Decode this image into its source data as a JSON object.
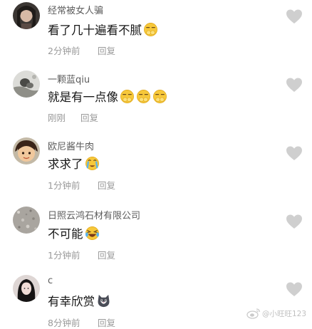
{
  "comments": [
    {
      "username": "经常被女人骗",
      "text": "看了几十遍看不腻",
      "emoji": "sneaky-hands-face-emoji",
      "time": "2分钟前",
      "reply_label": "回复"
    },
    {
      "username": "一颗蓝qiu",
      "text": "就是有一点像",
      "emoji": "sneaky-hands-face-emoji",
      "time": "刚刚",
      "reply_label": "回复"
    },
    {
      "username": "欧尼酱牛肉",
      "text": "求求了",
      "emoji": "crying-face-emoji",
      "time": "1分钟前",
      "reply_label": "回复"
    },
    {
      "username": "日照云鸿石材有限公司",
      "text": "不可能",
      "emoji": "laugh-cry-face-emoji",
      "time": "1分钟前",
      "reply_label": "回复"
    },
    {
      "username": "c",
      "text": "有幸欣赏",
      "emoji": "cat-face-emoji",
      "time": "8分钟前",
      "reply_label": "回复"
    }
  ],
  "watermark": {
    "text": "@小旺旺123",
    "icon": "weibo-icon"
  },
  "colors": {
    "username": "#5c5c5c",
    "text": "#161616",
    "meta": "#9a9a9a",
    "like_heart": "#cfcfcf",
    "emoji_yellow": "#f7c83a"
  }
}
